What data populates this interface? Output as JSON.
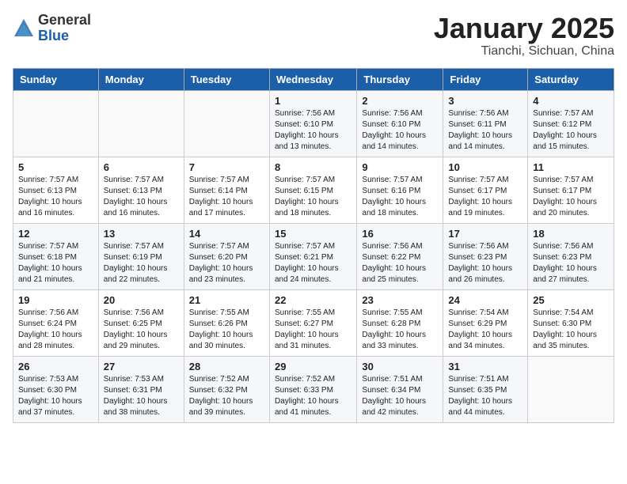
{
  "header": {
    "logo": {
      "general": "General",
      "blue": "Blue"
    },
    "title": "January 2025",
    "location": "Tianchi, Sichuan, China"
  },
  "days_of_week": [
    "Sunday",
    "Monday",
    "Tuesday",
    "Wednesday",
    "Thursday",
    "Friday",
    "Saturday"
  ],
  "weeks": [
    [
      {
        "day": "",
        "info": ""
      },
      {
        "day": "",
        "info": ""
      },
      {
        "day": "",
        "info": ""
      },
      {
        "day": "1",
        "info": "Sunrise: 7:56 AM\nSunset: 6:10 PM\nDaylight: 10 hours\nand 13 minutes."
      },
      {
        "day": "2",
        "info": "Sunrise: 7:56 AM\nSunset: 6:10 PM\nDaylight: 10 hours\nand 14 minutes."
      },
      {
        "day": "3",
        "info": "Sunrise: 7:56 AM\nSunset: 6:11 PM\nDaylight: 10 hours\nand 14 minutes."
      },
      {
        "day": "4",
        "info": "Sunrise: 7:57 AM\nSunset: 6:12 PM\nDaylight: 10 hours\nand 15 minutes."
      }
    ],
    [
      {
        "day": "5",
        "info": "Sunrise: 7:57 AM\nSunset: 6:13 PM\nDaylight: 10 hours\nand 16 minutes."
      },
      {
        "day": "6",
        "info": "Sunrise: 7:57 AM\nSunset: 6:13 PM\nDaylight: 10 hours\nand 16 minutes."
      },
      {
        "day": "7",
        "info": "Sunrise: 7:57 AM\nSunset: 6:14 PM\nDaylight: 10 hours\nand 17 minutes."
      },
      {
        "day": "8",
        "info": "Sunrise: 7:57 AM\nSunset: 6:15 PM\nDaylight: 10 hours\nand 18 minutes."
      },
      {
        "day": "9",
        "info": "Sunrise: 7:57 AM\nSunset: 6:16 PM\nDaylight: 10 hours\nand 18 minutes."
      },
      {
        "day": "10",
        "info": "Sunrise: 7:57 AM\nSunset: 6:17 PM\nDaylight: 10 hours\nand 19 minutes."
      },
      {
        "day": "11",
        "info": "Sunrise: 7:57 AM\nSunset: 6:17 PM\nDaylight: 10 hours\nand 20 minutes."
      }
    ],
    [
      {
        "day": "12",
        "info": "Sunrise: 7:57 AM\nSunset: 6:18 PM\nDaylight: 10 hours\nand 21 minutes."
      },
      {
        "day": "13",
        "info": "Sunrise: 7:57 AM\nSunset: 6:19 PM\nDaylight: 10 hours\nand 22 minutes."
      },
      {
        "day": "14",
        "info": "Sunrise: 7:57 AM\nSunset: 6:20 PM\nDaylight: 10 hours\nand 23 minutes."
      },
      {
        "day": "15",
        "info": "Sunrise: 7:57 AM\nSunset: 6:21 PM\nDaylight: 10 hours\nand 24 minutes."
      },
      {
        "day": "16",
        "info": "Sunrise: 7:56 AM\nSunset: 6:22 PM\nDaylight: 10 hours\nand 25 minutes."
      },
      {
        "day": "17",
        "info": "Sunrise: 7:56 AM\nSunset: 6:23 PM\nDaylight: 10 hours\nand 26 minutes."
      },
      {
        "day": "18",
        "info": "Sunrise: 7:56 AM\nSunset: 6:23 PM\nDaylight: 10 hours\nand 27 minutes."
      }
    ],
    [
      {
        "day": "19",
        "info": "Sunrise: 7:56 AM\nSunset: 6:24 PM\nDaylight: 10 hours\nand 28 minutes."
      },
      {
        "day": "20",
        "info": "Sunrise: 7:56 AM\nSunset: 6:25 PM\nDaylight: 10 hours\nand 29 minutes."
      },
      {
        "day": "21",
        "info": "Sunrise: 7:55 AM\nSunset: 6:26 PM\nDaylight: 10 hours\nand 30 minutes."
      },
      {
        "day": "22",
        "info": "Sunrise: 7:55 AM\nSunset: 6:27 PM\nDaylight: 10 hours\nand 31 minutes."
      },
      {
        "day": "23",
        "info": "Sunrise: 7:55 AM\nSunset: 6:28 PM\nDaylight: 10 hours\nand 33 minutes."
      },
      {
        "day": "24",
        "info": "Sunrise: 7:54 AM\nSunset: 6:29 PM\nDaylight: 10 hours\nand 34 minutes."
      },
      {
        "day": "25",
        "info": "Sunrise: 7:54 AM\nSunset: 6:30 PM\nDaylight: 10 hours\nand 35 minutes."
      }
    ],
    [
      {
        "day": "26",
        "info": "Sunrise: 7:53 AM\nSunset: 6:30 PM\nDaylight: 10 hours\nand 37 minutes."
      },
      {
        "day": "27",
        "info": "Sunrise: 7:53 AM\nSunset: 6:31 PM\nDaylight: 10 hours\nand 38 minutes."
      },
      {
        "day": "28",
        "info": "Sunrise: 7:52 AM\nSunset: 6:32 PM\nDaylight: 10 hours\nand 39 minutes."
      },
      {
        "day": "29",
        "info": "Sunrise: 7:52 AM\nSunset: 6:33 PM\nDaylight: 10 hours\nand 41 minutes."
      },
      {
        "day": "30",
        "info": "Sunrise: 7:51 AM\nSunset: 6:34 PM\nDaylight: 10 hours\nand 42 minutes."
      },
      {
        "day": "31",
        "info": "Sunrise: 7:51 AM\nSunset: 6:35 PM\nDaylight: 10 hours\nand 44 minutes."
      },
      {
        "day": "",
        "info": ""
      }
    ]
  ]
}
